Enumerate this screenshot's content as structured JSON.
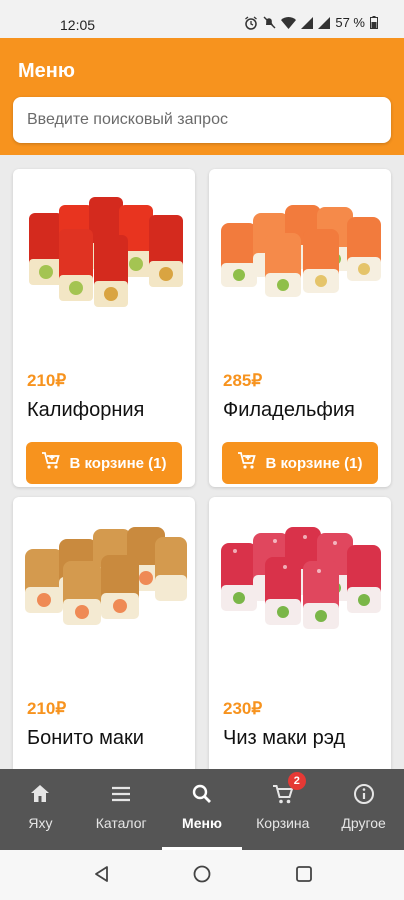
{
  "status_bar": {
    "time": "12:05",
    "battery_text": "57 %"
  },
  "header": {
    "title": "Меню"
  },
  "search": {
    "placeholder": "Введите поисковый запрос"
  },
  "products": [
    {
      "price": "210₽",
      "name": "Калифорния",
      "button_label": "В корзине (1)",
      "roll_style": "tobiko-red"
    },
    {
      "price": "285₽",
      "name": "Филадельфия",
      "button_label": "В корзине (1)",
      "roll_style": "salmon"
    },
    {
      "price": "210₽",
      "name": "Бонито маки",
      "button_label": "",
      "roll_style": "tempura"
    },
    {
      "price": "230₽",
      "name": "Чиз маки рэд",
      "button_label": "",
      "roll_style": "red-dotted"
    }
  ],
  "bottom_nav": {
    "items": [
      {
        "label": "Яху",
        "icon": "home-icon"
      },
      {
        "label": "Каталог",
        "icon": "menu-icon"
      },
      {
        "label": "Меню",
        "icon": "search-icon",
        "active": true
      },
      {
        "label": "Корзина",
        "icon": "cart-icon",
        "badge": "2"
      },
      {
        "label": "Другое",
        "icon": "info-icon"
      }
    ]
  },
  "colors": {
    "accent": "#f7931e",
    "nav_background": "#555555",
    "badge": "#e53935"
  }
}
